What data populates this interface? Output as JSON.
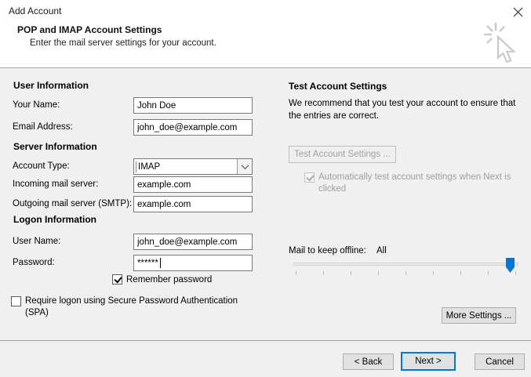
{
  "window": {
    "title": "Add Account"
  },
  "wizard_header": {
    "title": "POP and IMAP Account Settings",
    "subtitle": "Enter the mail server settings for your account."
  },
  "sections": {
    "user": {
      "heading": "User Information",
      "name_label": "Your Name:",
      "name_value": "John Doe",
      "email_label": "Email Address:",
      "email_value": "john_doe@example.com"
    },
    "server": {
      "heading": "Server Information",
      "type_label": "Account Type:",
      "type_value": "IMAP",
      "incoming_label": "Incoming mail server:",
      "incoming_value": "example.com",
      "outgoing_label": "Outgoing mail server (SMTP):",
      "outgoing_value": "example.com"
    },
    "logon": {
      "heading": "Logon Information",
      "user_label": "User Name:",
      "user_value": "john_doe@example.com",
      "password_label": "Password:",
      "password_value": "******",
      "remember": {
        "label": "Remember password",
        "checked": true
      },
      "spa": {
        "label": "Require logon using Secure Password Authentication (SPA)",
        "checked": false
      }
    }
  },
  "test": {
    "heading": "Test Account Settings",
    "description": "We recommend that you test your account to ensure that the entries are correct.",
    "button_label": "Test Account Settings ...",
    "auto": {
      "label": "Automatically test account settings when Next is clicked",
      "checked": true,
      "disabled": true
    }
  },
  "offline": {
    "label": "Mail to keep offline:",
    "value": "All",
    "tick_count": 9
  },
  "more_settings": {
    "label": "More Settings ..."
  },
  "footer": {
    "back": "< Back",
    "next": "Next >",
    "cancel": "Cancel"
  },
  "colors": {
    "accent": "#0078d7",
    "dialog_bg": "#f0f0f0",
    "header_bg": "#ffffff"
  }
}
